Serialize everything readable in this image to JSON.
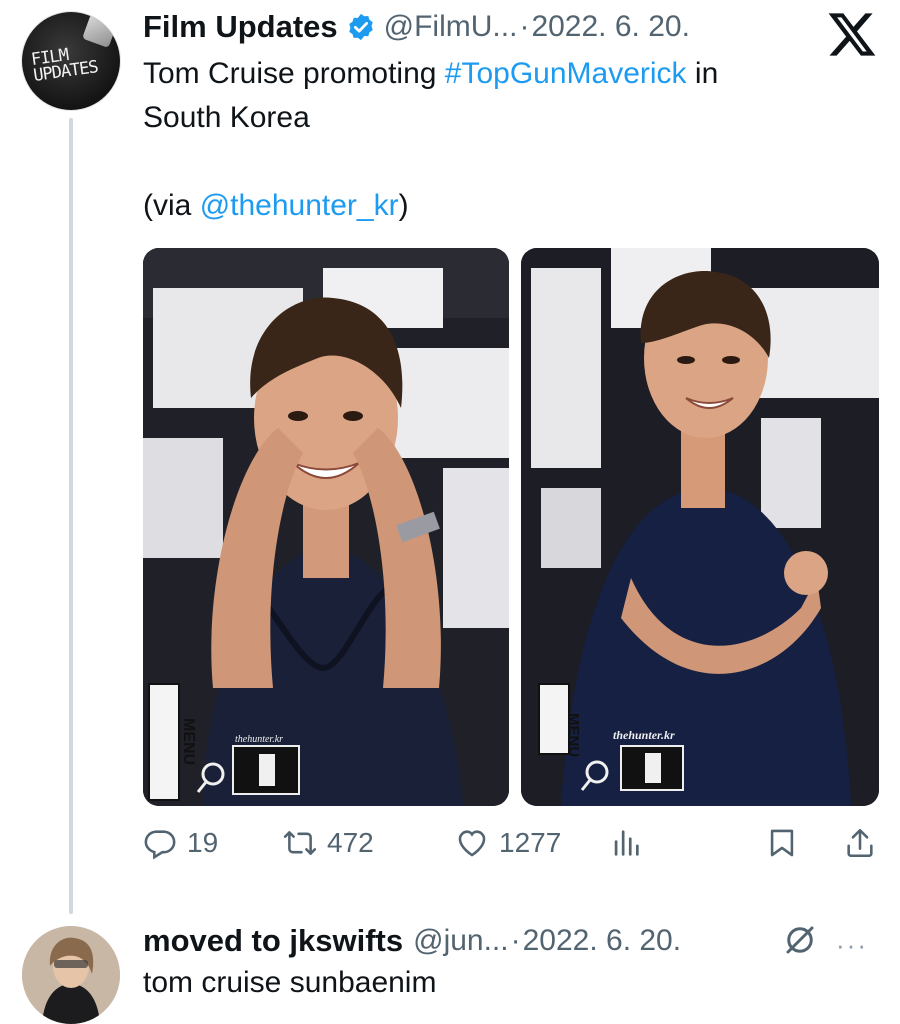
{
  "tweet": {
    "avatar_text": "FILM UPDATES",
    "author_name": "Film Updates",
    "handle": "@FilmU...",
    "separator": "·",
    "date": "2022. 6. 20.",
    "text_line1_before": "Tom Cruise promoting ",
    "hashtag": "#TopGunMaverick",
    "text_line1_after": " in",
    "text_line2": "South Korea",
    "via_prefix": "(via ",
    "mention": "@thehunter_kr",
    "via_suffix": ")",
    "media": [
      {
        "watermark": "thehunter.kr",
        "menu_label": "MENU"
      },
      {
        "watermark": "thehunter.kr",
        "menu_label": "MENU"
      }
    ],
    "stats": {
      "replies": "19",
      "retweets": "472",
      "likes": "1277"
    },
    "icons": [
      "x-logo-icon",
      "verified-badge-icon",
      "reply-icon",
      "retweet-icon",
      "like-icon",
      "views-icon",
      "bookmark-icon",
      "share-icon"
    ]
  },
  "reply": {
    "author_name": "moved to jkswifts",
    "handle": "@jun...",
    "separator": "·",
    "date": "2022. 6. 20.",
    "text": "tom cruise sunbaenim",
    "more": "···"
  },
  "colors": {
    "link": "#1d9bf0",
    "muted": "#536471",
    "text": "#0f1419",
    "verified": "#1d9bf0"
  }
}
